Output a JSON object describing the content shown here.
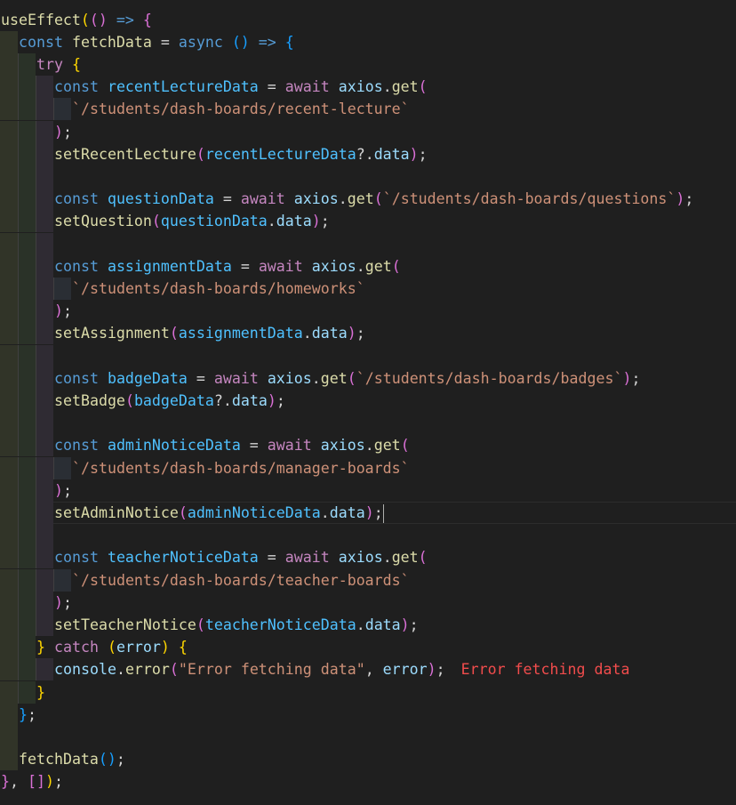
{
  "editor": {
    "inline_diagnostic": "Error fetching data",
    "lines": [
      {
        "indent": 0,
        "tokens": [
          {
            "text": "useEffect",
            "c": "t-fn"
          },
          {
            "text": "(",
            "c": "t-b1"
          },
          {
            "text": "()",
            "c": "t-b2"
          },
          {
            "text": " ",
            "c": "t-pun"
          },
          {
            "text": "=>",
            "c": "t-kw"
          },
          {
            "text": " ",
            "c": "t-pun"
          },
          {
            "text": "{",
            "c": "t-b2"
          }
        ]
      },
      {
        "indent": 1,
        "tokens": [
          {
            "text": "const",
            "c": "t-kw"
          },
          {
            "text": " ",
            "c": "t-pun"
          },
          {
            "text": "fetchData",
            "c": "t-fn"
          },
          {
            "text": " = ",
            "c": "t-pun"
          },
          {
            "text": "async",
            "c": "t-kw"
          },
          {
            "text": " ",
            "c": "t-pun"
          },
          {
            "text": "()",
            "c": "t-b3"
          },
          {
            "text": " ",
            "c": "t-pun"
          },
          {
            "text": "=>",
            "c": "t-kw"
          },
          {
            "text": " ",
            "c": "t-pun"
          },
          {
            "text": "{",
            "c": "t-b3"
          }
        ]
      },
      {
        "indent": 2,
        "tokens": [
          {
            "text": "try",
            "c": "t-ctl"
          },
          {
            "text": " ",
            "c": "t-pun"
          },
          {
            "text": "{",
            "c": "t-b1"
          }
        ]
      },
      {
        "indent": 3,
        "tokens": [
          {
            "text": "const",
            "c": "t-kw"
          },
          {
            "text": " ",
            "c": "t-pun"
          },
          {
            "text": "recentLectureData",
            "c": "t-const"
          },
          {
            "text": " = ",
            "c": "t-pun"
          },
          {
            "text": "await",
            "c": "t-ctl"
          },
          {
            "text": " ",
            "c": "t-pun"
          },
          {
            "text": "axios",
            "c": "t-var"
          },
          {
            "text": ".",
            "c": "t-pun"
          },
          {
            "text": "get",
            "c": "t-fn"
          },
          {
            "text": "(",
            "c": "t-b2"
          }
        ]
      },
      {
        "indent": 4,
        "tokens": [
          {
            "text": "`/students/dash-boards/recent-lecture`",
            "c": "t-str"
          }
        ]
      },
      {
        "indent": 3,
        "tokens": [
          {
            "text": ")",
            "c": "t-b2"
          },
          {
            "text": ";",
            "c": "t-pun"
          }
        ]
      },
      {
        "indent": 3,
        "tokens": [
          {
            "text": "setRecentLecture",
            "c": "t-fn"
          },
          {
            "text": "(",
            "c": "t-b2"
          },
          {
            "text": "recentLectureData",
            "c": "t-const"
          },
          {
            "text": "?.",
            "c": "t-pun"
          },
          {
            "text": "data",
            "c": "t-var"
          },
          {
            "text": ")",
            "c": "t-b2"
          },
          {
            "text": ";",
            "c": "t-pun"
          }
        ]
      },
      {
        "indent": 3,
        "tokens": []
      },
      {
        "indent": 3,
        "tokens": [
          {
            "text": "const",
            "c": "t-kw"
          },
          {
            "text": " ",
            "c": "t-pun"
          },
          {
            "text": "questionData",
            "c": "t-const"
          },
          {
            "text": " = ",
            "c": "t-pun"
          },
          {
            "text": "await",
            "c": "t-ctl"
          },
          {
            "text": " ",
            "c": "t-pun"
          },
          {
            "text": "axios",
            "c": "t-var"
          },
          {
            "text": ".",
            "c": "t-pun"
          },
          {
            "text": "get",
            "c": "t-fn"
          },
          {
            "text": "(",
            "c": "t-b2"
          },
          {
            "text": "`/students/dash-boards/questions`",
            "c": "t-str"
          },
          {
            "text": ")",
            "c": "t-b2"
          },
          {
            "text": ";",
            "c": "t-pun"
          }
        ]
      },
      {
        "indent": 3,
        "tokens": [
          {
            "text": "setQuestion",
            "c": "t-fn"
          },
          {
            "text": "(",
            "c": "t-b2"
          },
          {
            "text": "questionData",
            "c": "t-const"
          },
          {
            "text": ".",
            "c": "t-pun"
          },
          {
            "text": "data",
            "c": "t-var"
          },
          {
            "text": ")",
            "c": "t-b2"
          },
          {
            "text": ";",
            "c": "t-pun"
          }
        ]
      },
      {
        "indent": 3,
        "tokens": []
      },
      {
        "indent": 3,
        "tokens": [
          {
            "text": "const",
            "c": "t-kw"
          },
          {
            "text": " ",
            "c": "t-pun"
          },
          {
            "text": "assignmentData",
            "c": "t-const"
          },
          {
            "text": " = ",
            "c": "t-pun"
          },
          {
            "text": "await",
            "c": "t-ctl"
          },
          {
            "text": " ",
            "c": "t-pun"
          },
          {
            "text": "axios",
            "c": "t-var"
          },
          {
            "text": ".",
            "c": "t-pun"
          },
          {
            "text": "get",
            "c": "t-fn"
          },
          {
            "text": "(",
            "c": "t-b2"
          }
        ]
      },
      {
        "indent": 4,
        "tokens": [
          {
            "text": "`/students/dash-boards/homeworks`",
            "c": "t-str"
          }
        ]
      },
      {
        "indent": 3,
        "tokens": [
          {
            "text": ")",
            "c": "t-b2"
          },
          {
            "text": ";",
            "c": "t-pun"
          }
        ]
      },
      {
        "indent": 3,
        "tokens": [
          {
            "text": "setAssignment",
            "c": "t-fn"
          },
          {
            "text": "(",
            "c": "t-b2"
          },
          {
            "text": "assignmentData",
            "c": "t-const"
          },
          {
            "text": ".",
            "c": "t-pun"
          },
          {
            "text": "data",
            "c": "t-var"
          },
          {
            "text": ")",
            "c": "t-b2"
          },
          {
            "text": ";",
            "c": "t-pun"
          }
        ]
      },
      {
        "indent": 3,
        "tokens": []
      },
      {
        "indent": 3,
        "tokens": [
          {
            "text": "const",
            "c": "t-kw"
          },
          {
            "text": " ",
            "c": "t-pun"
          },
          {
            "text": "badgeData",
            "c": "t-const"
          },
          {
            "text": " = ",
            "c": "t-pun"
          },
          {
            "text": "await",
            "c": "t-ctl"
          },
          {
            "text": " ",
            "c": "t-pun"
          },
          {
            "text": "axios",
            "c": "t-var"
          },
          {
            "text": ".",
            "c": "t-pun"
          },
          {
            "text": "get",
            "c": "t-fn"
          },
          {
            "text": "(",
            "c": "t-b2"
          },
          {
            "text": "`/students/dash-boards/badges`",
            "c": "t-str"
          },
          {
            "text": ")",
            "c": "t-b2"
          },
          {
            "text": ";",
            "c": "t-pun"
          }
        ]
      },
      {
        "indent": 3,
        "tokens": [
          {
            "text": "setBadge",
            "c": "t-fn"
          },
          {
            "text": "(",
            "c": "t-b2"
          },
          {
            "text": "badgeData",
            "c": "t-const"
          },
          {
            "text": "?.",
            "c": "t-pun"
          },
          {
            "text": "data",
            "c": "t-var"
          },
          {
            "text": ")",
            "c": "t-b2"
          },
          {
            "text": ";",
            "c": "t-pun"
          }
        ]
      },
      {
        "indent": 3,
        "tokens": []
      },
      {
        "indent": 3,
        "tokens": [
          {
            "text": "const",
            "c": "t-kw"
          },
          {
            "text": " ",
            "c": "t-pun"
          },
          {
            "text": "adminNoticeData",
            "c": "t-const"
          },
          {
            "text": " = ",
            "c": "t-pun"
          },
          {
            "text": "await",
            "c": "t-ctl"
          },
          {
            "text": " ",
            "c": "t-pun"
          },
          {
            "text": "axios",
            "c": "t-var"
          },
          {
            "text": ".",
            "c": "t-pun"
          },
          {
            "text": "get",
            "c": "t-fn"
          },
          {
            "text": "(",
            "c": "t-b2"
          }
        ]
      },
      {
        "indent": 4,
        "tokens": [
          {
            "text": "`/students/dash-boards/manager-boards`",
            "c": "t-str"
          }
        ]
      },
      {
        "indent": 3,
        "tokens": [
          {
            "text": ")",
            "c": "t-b2"
          },
          {
            "text": ";",
            "c": "t-pun"
          }
        ]
      },
      {
        "indent": 3,
        "current": true,
        "tokens": [
          {
            "text": "setAdminNotice",
            "c": "t-fn"
          },
          {
            "text": "(",
            "c": "t-b2"
          },
          {
            "text": "adminNoticeData",
            "c": "t-const"
          },
          {
            "text": ".",
            "c": "t-pun"
          },
          {
            "text": "data",
            "c": "t-var"
          },
          {
            "text": ")",
            "c": "t-b2"
          },
          {
            "text": ";",
            "c": "t-pun"
          }
        ]
      },
      {
        "indent": 3,
        "tokens": []
      },
      {
        "indent": 3,
        "tokens": [
          {
            "text": "const",
            "c": "t-kw"
          },
          {
            "text": " ",
            "c": "t-pun"
          },
          {
            "text": "teacherNoticeData",
            "c": "t-const"
          },
          {
            "text": " = ",
            "c": "t-pun"
          },
          {
            "text": "await",
            "c": "t-ctl"
          },
          {
            "text": " ",
            "c": "t-pun"
          },
          {
            "text": "axios",
            "c": "t-var"
          },
          {
            "text": ".",
            "c": "t-pun"
          },
          {
            "text": "get",
            "c": "t-fn"
          },
          {
            "text": "(",
            "c": "t-b2"
          }
        ]
      },
      {
        "indent": 4,
        "tokens": [
          {
            "text": "`/students/dash-boards/teacher-boards`",
            "c": "t-str"
          }
        ]
      },
      {
        "indent": 3,
        "tokens": [
          {
            "text": ")",
            "c": "t-b2"
          },
          {
            "text": ";",
            "c": "t-pun"
          }
        ]
      },
      {
        "indent": 3,
        "tokens": [
          {
            "text": "setTeacherNotice",
            "c": "t-fn"
          },
          {
            "text": "(",
            "c": "t-b2"
          },
          {
            "text": "teacherNoticeData",
            "c": "t-const"
          },
          {
            "text": ".",
            "c": "t-pun"
          },
          {
            "text": "data",
            "c": "t-var"
          },
          {
            "text": ")",
            "c": "t-b2"
          },
          {
            "text": ";",
            "c": "t-pun"
          }
        ]
      },
      {
        "indent": 2,
        "tokens": [
          {
            "text": "}",
            "c": "t-b1"
          },
          {
            "text": " ",
            "c": "t-pun"
          },
          {
            "text": "catch",
            "c": "t-ctl"
          },
          {
            "text": " ",
            "c": "t-pun"
          },
          {
            "text": "(",
            "c": "t-b1"
          },
          {
            "text": "error",
            "c": "t-var"
          },
          {
            "text": ")",
            "c": "t-b1"
          },
          {
            "text": " ",
            "c": "t-pun"
          },
          {
            "text": "{",
            "c": "t-b1"
          }
        ]
      },
      {
        "indent": 3,
        "diagnostic": true,
        "tokens": [
          {
            "text": "console",
            "c": "t-var"
          },
          {
            "text": ".",
            "c": "t-pun"
          },
          {
            "text": "error",
            "c": "t-fn"
          },
          {
            "text": "(",
            "c": "t-b2"
          },
          {
            "text": "\"Error fetching data\"",
            "c": "t-str"
          },
          {
            "text": ", ",
            "c": "t-pun"
          },
          {
            "text": "error",
            "c": "t-var"
          },
          {
            "text": ")",
            "c": "t-b2"
          },
          {
            "text": ";",
            "c": "t-pun"
          }
        ]
      },
      {
        "indent": 2,
        "tokens": [
          {
            "text": "}",
            "c": "t-b1"
          }
        ]
      },
      {
        "indent": 1,
        "tokens": [
          {
            "text": "}",
            "c": "t-b3"
          },
          {
            "text": ";",
            "c": "t-pun"
          }
        ]
      },
      {
        "indent": 1,
        "tokens": []
      },
      {
        "indent": 1,
        "tokens": [
          {
            "text": "fetchData",
            "c": "t-fn"
          },
          {
            "text": "()",
            "c": "t-b3"
          },
          {
            "text": ";",
            "c": "t-pun"
          }
        ]
      },
      {
        "indent": 0,
        "tokens": [
          {
            "text": "}",
            "c": "t-b2"
          },
          {
            "text": ", ",
            "c": "t-pun"
          },
          {
            "text": "[]",
            "c": "t-b2"
          },
          {
            "text": ")",
            "c": "t-b1"
          },
          {
            "text": ";",
            "c": "t-pun"
          }
        ]
      }
    ]
  }
}
